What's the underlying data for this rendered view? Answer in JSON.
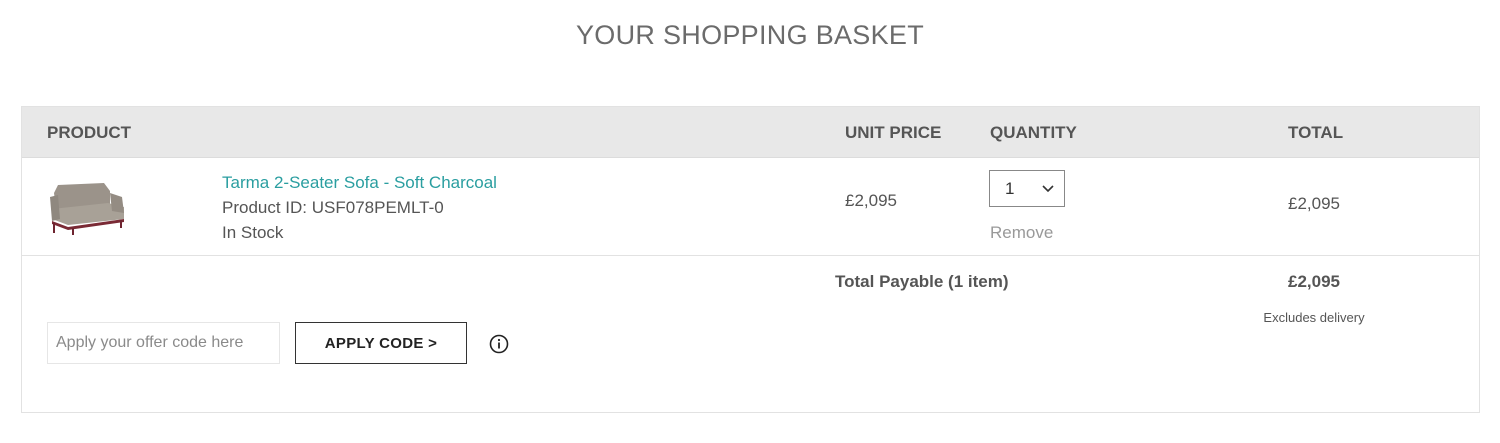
{
  "page": {
    "title": "YOUR SHOPPING BASKET"
  },
  "table": {
    "headers": {
      "product": "PRODUCT",
      "unit_price": "UNIT PRICE",
      "quantity": "QUANTITY",
      "total": "TOTAL"
    }
  },
  "items": [
    {
      "name": "Tarma 2-Seater Sofa - Soft Charcoal",
      "product_id": "Product ID: USF078PEMLT-0",
      "stock": "In Stock",
      "unit_price": "£2,095",
      "quantity": "1",
      "remove_label": "Remove",
      "total": "£2,095",
      "image_icon": "sofa-image"
    }
  ],
  "summary": {
    "label": "Total Payable (1 item)",
    "total": "£2,095",
    "note": "Excludes delivery"
  },
  "offer": {
    "placeholder": "Apply your offer code here",
    "value": "",
    "button_label": "APPLY CODE >",
    "info_icon": "info-icon"
  },
  "colors": {
    "link": "#2a9ea0",
    "header_bg": "#e8e8e8",
    "text": "#555555"
  }
}
